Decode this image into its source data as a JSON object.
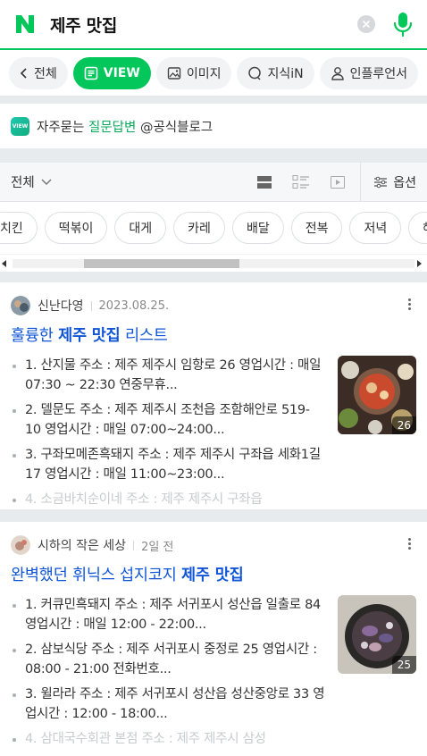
{
  "search": {
    "query": "제주 맛집"
  },
  "tabs": [
    {
      "label": "전체"
    },
    {
      "label": "VIEW"
    },
    {
      "label": "이미지"
    },
    {
      "label": "지식iN"
    },
    {
      "label": "인플루언서"
    }
  ],
  "faq": {
    "badge": "VIEW",
    "prefix": "자주묻는 ",
    "highlight": "질문답변",
    "suffix": " @공식블로그"
  },
  "filter": {
    "selected": "전체",
    "options_label": "옵션"
  },
  "chips": [
    "치킨",
    "떡볶이",
    "대게",
    "카레",
    "배달",
    "전복",
    "저녁",
    "해물탕"
  ],
  "posts": [
    {
      "author": "신난다영",
      "date": "2023.08.25.",
      "title_pre": "훌륭한 ",
      "title_bold": "제주 맛집",
      "title_post": " 리스트",
      "items": [
        "1. 산지물 주소 : 제주 제주시 임항로 26 영업시간 : 매일 07:30 ~ 22:30 연중무휴...",
        "2. 델문도 주소 : 제주 제주시 조천읍 조함해안로 519-10 영업시간 : 매일 07:00~24:00...",
        "3. 구좌모메존흑돼지 주소 : 제주 제주시 구좌읍 세화1길 17 영업시간 : 매일 11:00~23:00...",
        "4. 소금바치순이네 주소 : 제주 제주시 구좌읍"
      ],
      "image_count": "26"
    },
    {
      "author": "시하의 작은 세상",
      "date": "2일 전",
      "title_pre": "완벽했던 휘닉스 섭지코지 ",
      "title_bold": "제주 맛집",
      "title_post": "",
      "items": [
        "1. 커큐민흑돼지 주소 : 제주 서귀포시 성산읍 일출로 84 영업시간 : 매일 12:00 - 22:00...",
        "2. 삼보식당 주소 : 제주 서귀포시 중정로 25 영업시간 : 08:00 - 21:00 전화번호...",
        "3. 윌라라 주소 : 제주 서귀포시 성산읍 성산중앙로 33 영업시간 : 12:00 - 18:00...",
        "4. 삼대국수회관 본점 주소 : 제주 제주시 삼성"
      ],
      "image_count": "25"
    }
  ]
}
